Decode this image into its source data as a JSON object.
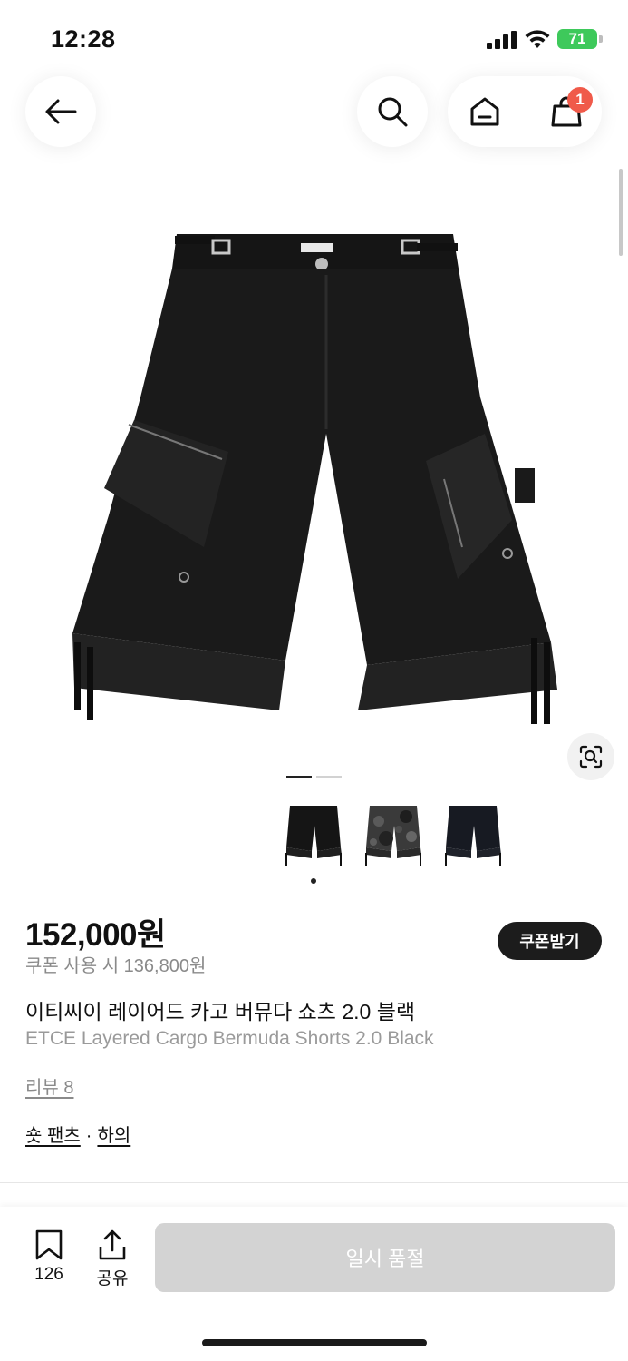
{
  "status_bar": {
    "time": "12:28",
    "battery": "71"
  },
  "nav": {
    "cart_count": "1"
  },
  "gallery": {
    "image_count": 3,
    "active_index": 1
  },
  "product": {
    "price": "152,000원",
    "coupon_price": "쿠폰 사용 시 136,800원",
    "coupon_button": "쿠폰받기",
    "title_ko": "이티씨이 레이어드 카고 버뮤다 쇼츠 2.0 블랙",
    "title_en": "ETCE Layered Cargo Bermuda Shorts 2.0 Black",
    "reviews": "리뷰 8",
    "category_1": "숏 팬츠",
    "category_sep": "·",
    "category_2": "하의"
  },
  "bottom_bar": {
    "save_count": "126",
    "share_label": "공유",
    "soldout_label": "일시 품절"
  },
  "colors": {
    "accent_badge": "#f05a4a",
    "battery": "#3ec95b",
    "disabled_button": "#d3d3d3"
  }
}
